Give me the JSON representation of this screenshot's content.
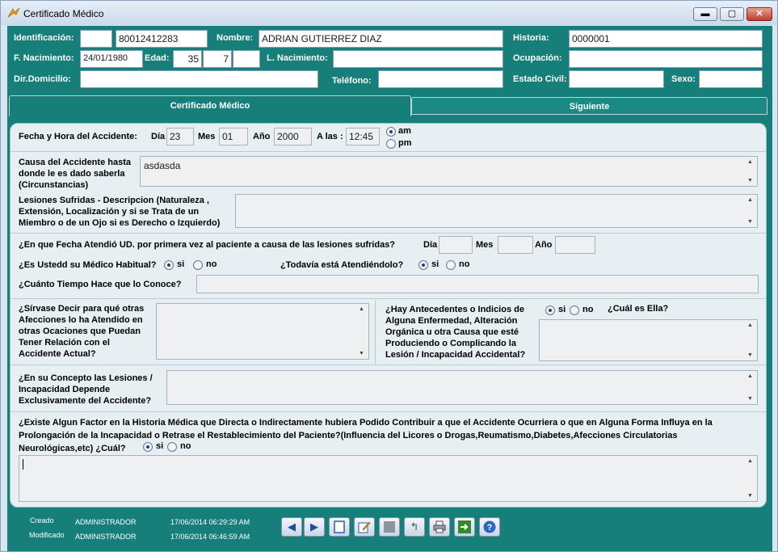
{
  "window": {
    "title": "Certificado Médico",
    "min_glyph": "▬",
    "max_glyph": "▢",
    "close_glyph": "✕"
  },
  "header": {
    "identificacion_label": "Identificación:",
    "identificacion_type": "",
    "identificacion_value": "80012412283",
    "nombre_label": "Nombre:",
    "nombre_value": "ADRIAN GUTIERREZ DIAZ",
    "historia_label": "Historia:",
    "historia_value": "0000001",
    "fnac_label": "F. Nacimiento:",
    "fnac_value": "24/01/1980",
    "edad_label": "Edad:",
    "edad_years": "35",
    "edad_months": "7",
    "edad_days": "",
    "lnac_label": "L. Nacimiento:",
    "lnac_value": "",
    "ocupacion_label": "Ocupación:",
    "ocupacion_value": "",
    "domicilio_label": "Dir.Domicilio:",
    "domicilio_value": "",
    "telefono_label": "Teléfono:",
    "telefono_value": "",
    "estado_civil_label": "Estado Civil:",
    "estado_civil_value": "",
    "sexo_label": "Sexo:",
    "sexo_value": ""
  },
  "tabs": {
    "active": "Certificado Médico",
    "next": "Siguiente"
  },
  "form": {
    "fecha_hora_label": "Fecha y Hora del Accidente:",
    "dia_label": "Día",
    "dia_value": "23",
    "mes_label": "Mes",
    "mes_value": "01",
    "anio_label": "Año",
    "anio_value": "2000",
    "alas_label": "A las :",
    "hora_value": "12:45",
    "am_label": "am",
    "pm_label": "pm",
    "ampm_selected": "am",
    "causa_label": "Causa del Accidente hasta donde le es dado saberla (Circunstancias)",
    "causa_value": "asdasda",
    "lesiones_label": "Lesiones Sufridas - Descripcion (Naturaleza , Extensión, Localización y si se Trata  de un Miembro o de un Ojo si es Derecho o Izquierdo)",
    "lesiones_value": "",
    "primera_vez_label": "¿En que Fecha Atendió UD. por primera vez al paciente a causa de las lesiones sufridas?",
    "pv_dia_label": "Día",
    "pv_dia_value": "",
    "pv_mes_label": "Mes",
    "pv_mes_value": "",
    "pv_anio_label": "Año",
    "pv_anio_value": "",
    "medico_habitual_label": "¿Es Ustedd su Médico Habitual?",
    "todavia_label": "¿Todavía está Atendiéndolo?",
    "si_label": "si",
    "no_label": "no",
    "cuanto_tiempo_label": "¿Cuánto Tiempo Hace que lo Conoce?",
    "cuanto_tiempo_value": "",
    "otras_afecciones_label": "¿Sírvase Decir para qué otras Afecciones lo ha Atendido en otras Ocaciones que Puedan Tener Relación con el Accidente Actual?",
    "otras_afecciones_value": "",
    "antecedentes_label": "¿Hay Antecedentes o Indicios de Alguna Enfermedad, Alteración Orgánica u otra Causa que esté Produciendo o Complicando  la Lesión / Incapacidad Accidental?",
    "cual_es_ella_label": "¿Cuál es Ella?",
    "antecedentes_value": "",
    "concepto_label": "¿En su Concepto las Lesiones / Incapacidad Depende Exclusivamente del Accidente?",
    "concepto_value": "",
    "factor_label": "¿Existe Algun Factor en la Historia Médica que Directa o Indirectamente hubiera Podido Contribuir a que el Accidente Ocurriera o que en Alguna Forma Influya en la Prolongación de la Incapacidad o Retrase el Restablecimiento del Paciente?(Influencia del Licores o Drogas,Reumatismo,Diabetes,Afecciones Circulatorias Neurológicas,etc)  ¿Cuál?",
    "factor_value": ""
  },
  "footer": {
    "creado_label": "Creado",
    "creado_user": "ADMINISTRADOR",
    "creado_date": "17/06/2014 06:29:29 AM",
    "modificado_label": "Modificado",
    "modificado_user": "ADMINISTRADOR",
    "modificado_date": "17/06/2014 06:46:59 AM"
  },
  "toolbar": {
    "icons": [
      "arrow-left-icon",
      "arrow-right-icon",
      "new-document-icon",
      "edit-icon",
      "stop-icon",
      "undo-icon",
      "print-icon",
      "exit-icon",
      "help-icon"
    ]
  },
  "colors": {
    "accent": "#167f7a",
    "panel": "#e7eff3"
  }
}
